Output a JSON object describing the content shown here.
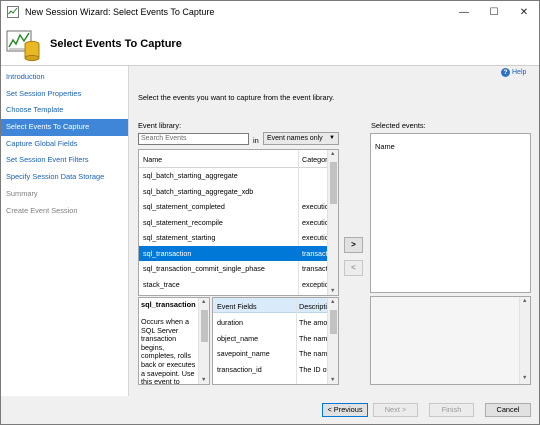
{
  "window": {
    "title": "New Session Wizard: Select Events To Capture",
    "minimize": "—",
    "maximize": "☐",
    "close": "✕"
  },
  "header": {
    "title": "Select Events To Capture"
  },
  "nav": {
    "items": [
      {
        "label": "Introduction",
        "state": "link"
      },
      {
        "label": "Set Session Properties",
        "state": "link"
      },
      {
        "label": "Choose Template",
        "state": "link"
      },
      {
        "label": "Select Events To Capture",
        "state": "selected"
      },
      {
        "label": "Capture Global Fields",
        "state": "link"
      },
      {
        "label": "Set Session Event Filters",
        "state": "link"
      },
      {
        "label": "Specify Session Data Storage",
        "state": "link"
      },
      {
        "label": "Summary",
        "state": "disabled"
      },
      {
        "label": "Create Event Session",
        "state": "disabled"
      }
    ]
  },
  "help": {
    "label": "Help",
    "glyph": "?"
  },
  "instructions": "Select the events you want to capture from the event library.",
  "library": {
    "label": "Event library:",
    "search_placeholder": "Search Events",
    "in_label": "in",
    "filter_selected": "Event names only",
    "columns": [
      "Name",
      "Category"
    ],
    "rows": [
      {
        "name": "sql_batch_starting_aggregate",
        "category": ""
      },
      {
        "name": "sql_batch_starting_aggregate_xdb",
        "category": ""
      },
      {
        "name": "sql_statement_completed",
        "category": "execution"
      },
      {
        "name": "sql_statement_recompile",
        "category": "execution"
      },
      {
        "name": "sql_statement_starting",
        "category": "execution"
      },
      {
        "name": "sql_transaction",
        "category": "transactions",
        "selected": true
      },
      {
        "name": "sql_transaction_commit_single_phase",
        "category": "transactions"
      },
      {
        "name": "stack_trace",
        "category": "exception"
      }
    ]
  },
  "description": {
    "title": "sql_transaction",
    "text": "Occurs when a SQL Server transaction begins, completes, rolls back or executes a savepoint. Use this event to"
  },
  "event_fields": {
    "columns": [
      "Event Fields",
      "Description"
    ],
    "rows": [
      {
        "name": "duration",
        "desc": "The amount"
      },
      {
        "name": "object_name",
        "desc": "The name"
      },
      {
        "name": "savepoint_name",
        "desc": "The name"
      },
      {
        "name": "transaction_id",
        "desc": "The ID of"
      }
    ]
  },
  "selected_events": {
    "label": "Selected events:",
    "column": "Name"
  },
  "move": {
    "add": ">",
    "remove": "<"
  },
  "buttons": {
    "previous": "< Previous",
    "next": "Next >",
    "finish": "Finish",
    "cancel": "Cancel"
  },
  "colors": {
    "accent": "#0078d7",
    "nav_selected": "#3f86d8",
    "link": "#1b61b6"
  }
}
